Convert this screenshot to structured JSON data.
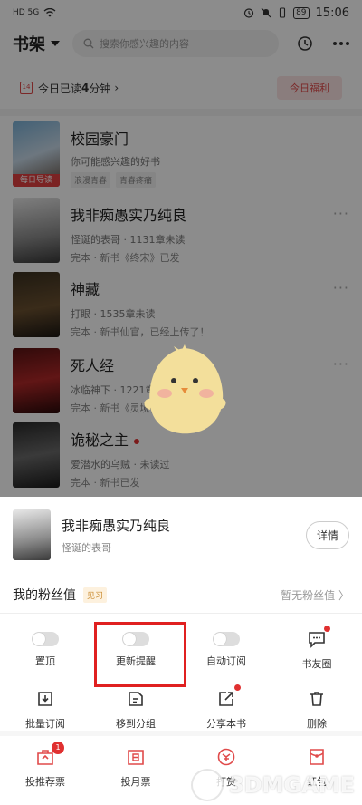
{
  "status_bar": {
    "left": "HD 5G",
    "battery": "89",
    "time": "15:06"
  },
  "header": {
    "title": "书架",
    "search_placeholder": "搜索你感兴趣的内容"
  },
  "reading": {
    "calendar_day": "14",
    "text_prefix": "今日已读",
    "minutes": "4",
    "text_suffix": "分钟",
    "welfare_label": "今日福利"
  },
  "books": [
    {
      "title": "校园豪门",
      "line1": "你可能感兴趣的好书",
      "tags": [
        "浪漫青春",
        "青春疼痛"
      ],
      "badge": "每日导读"
    },
    {
      "title": "我非痴愚实乃纯良",
      "line1": "怪诞的表哥 · 1131章未读",
      "line2": "完本 · 新书《终宋》已发"
    },
    {
      "title": "神藏",
      "line1": "打眼 · 1535章未读",
      "line2": "完本 · 新书仙官，已经上传了！"
    },
    {
      "title": "死人经",
      "line1": "冰临神下 · 1221章未读",
      "line2": "完本 · 新书《灵境行者》已发"
    },
    {
      "title": "诡秘之主",
      "line1": "爱潜水的乌贼 · 未读过",
      "line2": "完本 · 新书已发"
    }
  ],
  "sheet": {
    "book_title": "我非痴愚实乃纯良",
    "book_author": "怪诞的表哥",
    "detail_label": "详情",
    "fans_label": "我的粉丝值",
    "fans_badge": "见习",
    "fans_value": "暂无粉丝值 〉",
    "row1": [
      "置顶",
      "更新提醒",
      "自动订阅",
      "书友圈"
    ],
    "row2": [
      "批量订阅",
      "移到分组",
      "分享本书",
      "删除"
    ],
    "row3": [
      "投推荐票",
      "投月票",
      "打赏",
      "红包"
    ],
    "recommend_badge": "1"
  },
  "watermark": "3DMGAME",
  "colors": {
    "accent": "#e04a4a",
    "highlight": "#e02020",
    "dot": "#e03030"
  }
}
